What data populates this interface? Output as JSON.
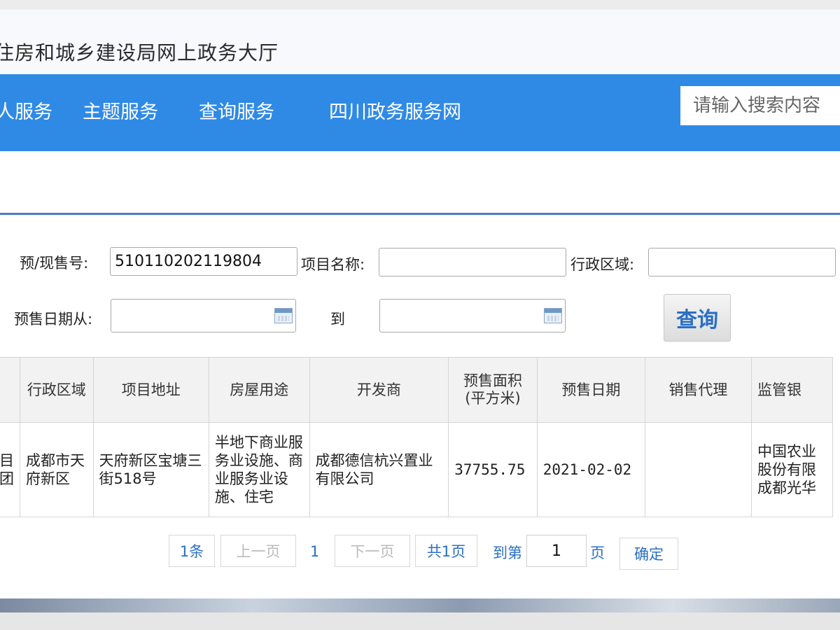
{
  "header": {
    "site_title": "住房和城乡建设局网上政务大厅"
  },
  "nav": {
    "items": [
      "人服务",
      "主题服务",
      "查询服务",
      "四川政务服务网"
    ],
    "search_placeholder": "请输入搜索内容"
  },
  "form": {
    "presale_no_label": "预/现售号:",
    "presale_no_value": "510110202119804",
    "project_name_label": "项目名称:",
    "project_name_value": "",
    "district_label": "行政区域:",
    "district_value": "",
    "date_from_label": "预售日期从:",
    "date_from_value": "",
    "date_to_label": "到",
    "date_to_value": "",
    "query_button": "查询"
  },
  "table": {
    "headers": [
      "",
      "行政区域",
      "项目地址",
      "房屋用途",
      "开发商",
      "预售面积(平方米)",
      "预售日期",
      "销售代理",
      "监管银"
    ],
    "rows": [
      [
        "目团",
        "成都市天府新区",
        "天府新区宝塘三街518号",
        "半地下商业服务业设施、商业服务业设施、住宅",
        "成都德信杭兴置业有限公司",
        "37755.75",
        "2021-02-02",
        "",
        "中国农业股份有限成都光华"
      ]
    ]
  },
  "pager": {
    "count": "1条",
    "prev": "上一页",
    "current": "1",
    "next": "下一页",
    "total": "共1页",
    "goto_label": "到第",
    "goto_value": "1",
    "page_suffix": "页",
    "confirm": "确定"
  }
}
